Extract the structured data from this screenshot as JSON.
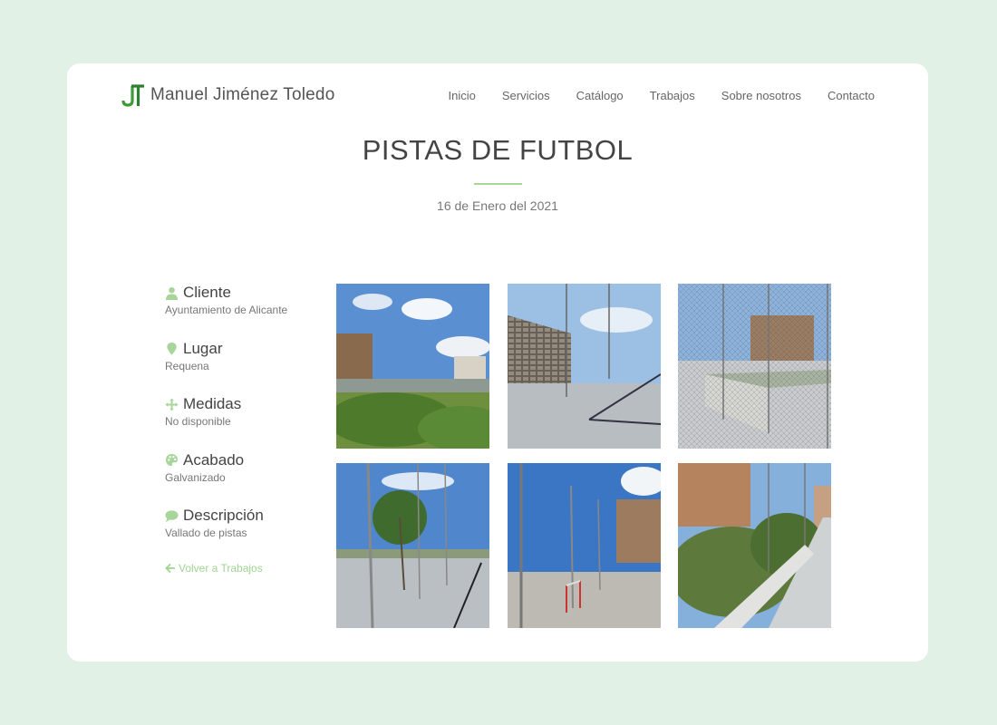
{
  "header": {
    "logo_text": "Manuel Jiménez Toledo",
    "nav": [
      "Inicio",
      "Servicios",
      "Catálogo",
      "Trabajos",
      "Sobre nosotros",
      "Contacto"
    ]
  },
  "page": {
    "title": "PISTAS DE FUTBOL",
    "date": "16 de Enero del 2021"
  },
  "info": [
    {
      "icon": "user-icon",
      "label": "Cliente",
      "value": "Ayuntamiento de Alicante"
    },
    {
      "icon": "location-pin-icon",
      "label": "Lugar",
      "value": "Requena"
    },
    {
      "icon": "arrows-move-icon",
      "label": "Medidas",
      "value": "No disponible"
    },
    {
      "icon": "palette-icon",
      "label": "Acabado",
      "value": "Galvanizado"
    },
    {
      "icon": "comment-icon",
      "label": "Descripción",
      "value": "Vallado de pistas"
    }
  ],
  "back_link": "Volver a Trabajos",
  "colors": {
    "background": "#e1f1e5",
    "accent": "#a7d59a",
    "logo_green": "#3f9b3a"
  }
}
